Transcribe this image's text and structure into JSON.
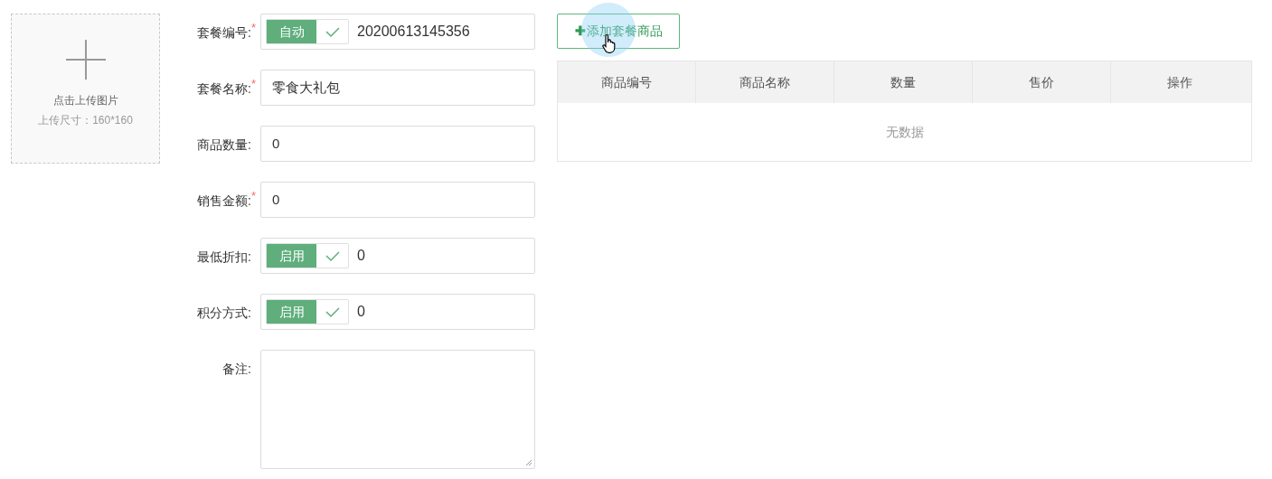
{
  "upload": {
    "title": "点击上传图片",
    "hint": "上传尺寸：160*160"
  },
  "fields": [
    {
      "label": "套餐编号:",
      "required_mark": "*",
      "kind": "toggle",
      "toggle_label": "自动",
      "checked": true,
      "value": "20200613145356"
    },
    {
      "label": "套餐名称:",
      "required_mark": "*",
      "kind": "text",
      "value": "零食大礼包"
    },
    {
      "label": "商品数量:",
      "kind": "text",
      "value": "0"
    },
    {
      "label": "销售金额:",
      "required_mark": "*",
      "kind": "text",
      "value": "0"
    },
    {
      "label": "最低折扣:",
      "kind": "toggle",
      "toggle_label": "启用",
      "checked": true,
      "value": "0"
    },
    {
      "label": "积分方式:",
      "kind": "toggle",
      "toggle_label": "启用",
      "checked": true,
      "value": "0"
    },
    {
      "label": "备注:",
      "kind": "textarea"
    }
  ],
  "add_button": {
    "icon": "✚",
    "label": "添加套餐商品"
  },
  "table": {
    "columns": [
      "商品编号",
      "商品名称",
      "数量",
      "售价",
      "操作"
    ],
    "empty_text": "无数据"
  }
}
